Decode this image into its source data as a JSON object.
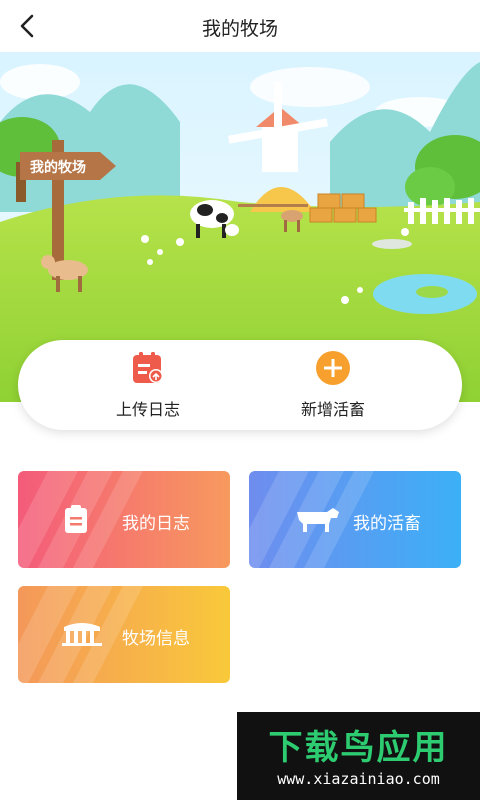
{
  "header": {
    "title": "我的牧场",
    "back_icon": "chevron-left-icon"
  },
  "hero": {
    "sign_text": "我的牧场"
  },
  "actions": [
    {
      "label": "上传日志",
      "icon": "upload-log-icon",
      "color": "#ee5b4b"
    },
    {
      "label": "新增活畜",
      "icon": "plus-circle-icon",
      "color": "#f7a02e"
    }
  ],
  "tiles": [
    {
      "label": "我的日志",
      "icon": "clipboard-icon",
      "gradient": [
        "#f45b7a",
        "#f79a5e"
      ]
    },
    {
      "label": "我的活畜",
      "icon": "cow-icon",
      "gradient": [
        "#6f8dee",
        "#3cb0f7"
      ]
    },
    {
      "label": "牧场信息",
      "icon": "fence-icon",
      "gradient": [
        "#f4985a",
        "#f9c93a"
      ]
    }
  ],
  "watermark": {
    "main": "下载鸟应用",
    "url": "www.xiazainiao.com"
  }
}
